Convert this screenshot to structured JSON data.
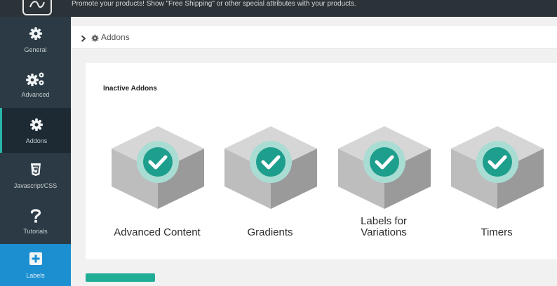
{
  "header": {
    "description": "Promote your products! Show \"Free Shipping\" or other special attributes with your products."
  },
  "sidebar": {
    "items": [
      {
        "label": "General",
        "icon": "gear-icon"
      },
      {
        "label": "Advanced",
        "icon": "gears-icon"
      },
      {
        "label": "Addons",
        "icon": "gear-icon",
        "active": true
      },
      {
        "label": "Javascript/CSS",
        "icon": "css3-icon"
      },
      {
        "label": "Tutorials",
        "icon": "question-icon"
      },
      {
        "label": "Labels",
        "icon": "plus-square-icon"
      }
    ]
  },
  "breadcrumb": {
    "current": "Addons"
  },
  "main": {
    "section_title": "Inactive Addons",
    "addons": [
      {
        "name_line1": "Advanced Content",
        "name_line2": ""
      },
      {
        "name_line1": "Gradients",
        "name_line2": ""
      },
      {
        "name_line1": "Labels for",
        "name_line2": "Variations"
      },
      {
        "name_line1": "Timers",
        "name_line2": ""
      }
    ]
  },
  "colors": {
    "accent": "#27b6a8",
    "check": "#1e9e8d",
    "sidebar": "#2b3a44",
    "labels_blue": "#1b8fd0"
  }
}
